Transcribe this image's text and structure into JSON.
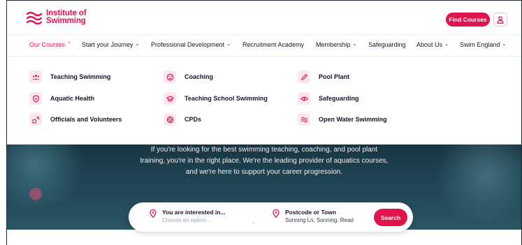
{
  "brand": {
    "line1": "Institute of",
    "line2": "Swimming",
    "color": "#e0144c"
  },
  "header": {
    "find_courses": "Find Courses",
    "account_icon": "user-icon"
  },
  "nav": {
    "items": [
      {
        "label": "Our Courses",
        "chevron": "^",
        "active": true
      },
      {
        "label": "Start your Journey",
        "chevron": "v"
      },
      {
        "label": "Professional Development",
        "chevron": "v"
      },
      {
        "label": "Recruitment Academy"
      },
      {
        "label": "Membership",
        "chevron": "v"
      },
      {
        "label": "Safeguarding"
      },
      {
        "label": "About Us",
        "chevron": "v"
      },
      {
        "label": "Swim England",
        "chevron": "v"
      }
    ]
  },
  "dropdown": {
    "items": [
      {
        "label": "Teaching Swimming",
        "icon": "group-icon"
      },
      {
        "label": "Coaching",
        "icon": "coaching-icon"
      },
      {
        "label": "Pool Plant",
        "icon": "pen-icon"
      },
      {
        "label": "Aquatic Health",
        "icon": "shield-icon"
      },
      {
        "label": "Teaching School Swimming",
        "icon": "graduation-cap-icon"
      },
      {
        "label": "Safeguarding",
        "icon": "eye-icon"
      },
      {
        "label": "Officials and Volunteers",
        "icon": "volunteers-icon"
      },
      {
        "label": "CPDs",
        "icon": "lifebuoy-icon"
      },
      {
        "label": "Open Water Swimming",
        "icon": "waves-icon"
      }
    ]
  },
  "hero": {
    "line1": "If you're looking for the best swimming teaching, coaching, and pool plant",
    "line2": "training, you're in the right place. We're the leading provider of aquatics courses,",
    "line3": "and we're here to support your career progression."
  },
  "search": {
    "interest_title": "You are interested in...",
    "interest_placeholder": "Choose an option...",
    "location_title": "Postcode or Town",
    "location_value": "Sonning Ln, Sonning, Read",
    "button": "Search"
  }
}
